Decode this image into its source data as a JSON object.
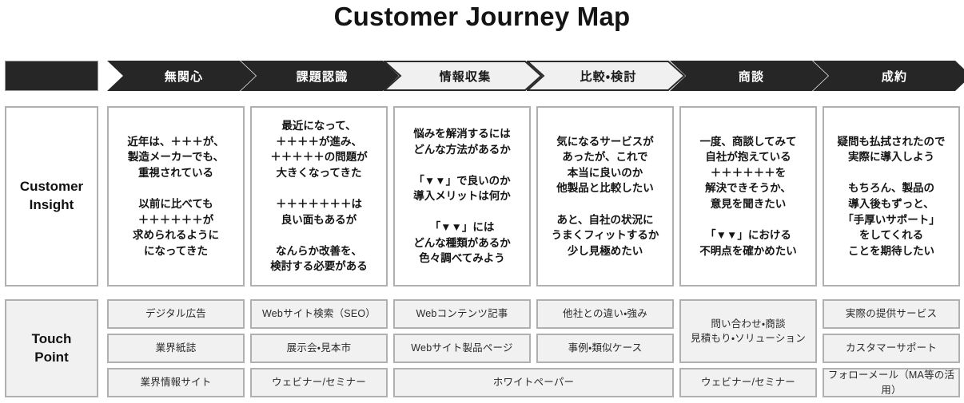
{
  "title": "Customer Journey Map",
  "header": {
    "corner": "",
    "stages": [
      {
        "label": "無関心",
        "style": "dark"
      },
      {
        "label": "課題認識",
        "style": "dark"
      },
      {
        "label": "情報収集",
        "style": "light"
      },
      {
        "label": "比較・検討",
        "style": "light"
      },
      {
        "label": "商談",
        "style": "dark"
      },
      {
        "label": "成約",
        "style": "dark"
      }
    ]
  },
  "rows": {
    "insight": {
      "label": "Customer\nInsight",
      "cells": [
        "近年は、＋＋＋が、\n製造メーカーでも、\n重視されている\n\n以前に比べても\n＋＋＋＋＋＋が\n求められるように\nになってきた",
        "最近になって、\n＋＋＋＋が進み、\n＋＋＋＋＋の問題が\n大きくなってきた\n\n＋＋＋＋＋＋＋は\n良い面もあるが\n\nなんらか改善を、\n検討する必要がある",
        "悩みを解消するには\nどんな方法があるか\n\n「▼▼」で良いのか\n導入メリットは何か\n\n「▼▼」には\nどんな種類があるか\n色々調べてみよう",
        "気になるサービスが\nあったが、これで\n本当に良いのか\n他製品と比較したい\n\nあと、自社の状況に\nうまくフィットするか\n少し見極めたい",
        "一度、商談してみて\n自社が抱えている\n＋＋＋＋＋＋を\n解決できそうか、\n意見を聞きたい\n\n「▼▼」における\n不明点を確かめたい",
        "疑問も払拭されたので\n実際に導入しよう\n\nもちろん、製品の\n導入後もずっと、\n「手厚いサポート」\nをしてくれる\nことを期待したい"
      ]
    },
    "touchpoint": {
      "label": "Touch\nPoint",
      "items": [
        {
          "text": "デジタル広告",
          "col": 1,
          "span": 1,
          "row": 1,
          "rowspan": 1
        },
        {
          "text": "業界紙誌",
          "col": 1,
          "span": 1,
          "row": 2,
          "rowspan": 1
        },
        {
          "text": "業界情報サイト",
          "col": 1,
          "span": 1,
          "row": 3,
          "rowspan": 1
        },
        {
          "text": "Webサイト検索（SEO）",
          "col": 2,
          "span": 1,
          "row": 1,
          "rowspan": 1
        },
        {
          "text": "展示会・見本市",
          "col": 2,
          "span": 1,
          "row": 2,
          "rowspan": 1
        },
        {
          "text": "ウェビナー/セミナー",
          "col": 2,
          "span": 1,
          "row": 3,
          "rowspan": 1
        },
        {
          "text": "Webコンテンツ記事",
          "col": 3,
          "span": 1,
          "row": 1,
          "rowspan": 1
        },
        {
          "text": "Webサイト製品ページ",
          "col": 3,
          "span": 1,
          "row": 2,
          "rowspan": 1
        },
        {
          "text": "他社との違い・強み",
          "col": 4,
          "span": 1,
          "row": 1,
          "rowspan": 1
        },
        {
          "text": "事例・類似ケース",
          "col": 4,
          "span": 1,
          "row": 2,
          "rowspan": 1
        },
        {
          "text": "ホワイトペーパー",
          "col": 3,
          "span": 2,
          "row": 3,
          "rowspan": 1
        },
        {
          "text": "問い合わせ・商談\n見積もり・ソリューション",
          "col": 5,
          "span": 1,
          "row": 1,
          "rowspan": 2
        },
        {
          "text": "ウェビナー/セミナー",
          "col": 5,
          "span": 1,
          "row": 3,
          "rowspan": 1
        },
        {
          "text": "実際の提供サービス",
          "col": 6,
          "span": 1,
          "row": 1,
          "rowspan": 1
        },
        {
          "text": "カスタマーサポート",
          "col": 6,
          "span": 1,
          "row": 2,
          "rowspan": 1
        },
        {
          "text": "フォローメール（MA等の活用）",
          "col": 6,
          "span": 1,
          "row": 3,
          "rowspan": 1
        }
      ]
    }
  },
  "colors": {
    "dark": "#262626",
    "light": "#f0f0f0",
    "border": "#b0b0b0",
    "tp_fill": "#f1f1f1",
    "text": "#141414"
  }
}
